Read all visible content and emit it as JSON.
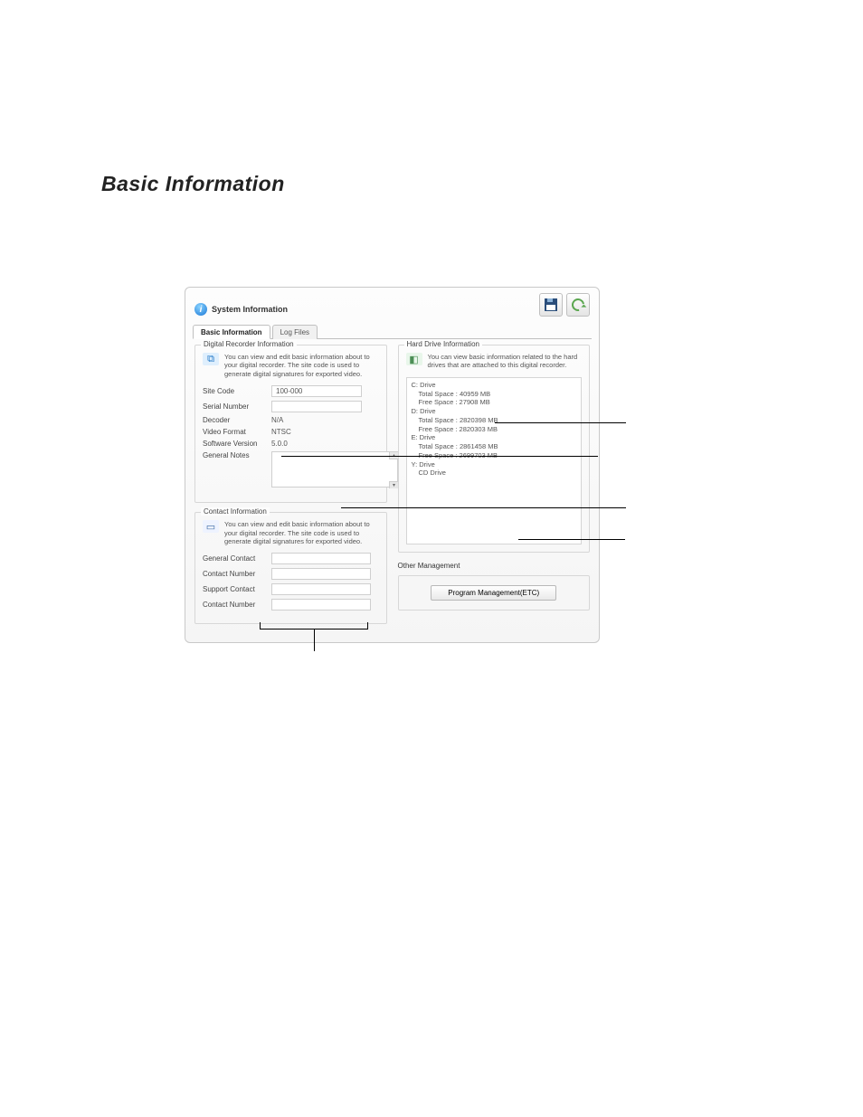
{
  "document": {
    "heading": "Basic Information"
  },
  "dialog": {
    "title": "System Information",
    "header_buttons": {
      "save": "save",
      "recycle": "recycle"
    },
    "tabs": {
      "basic": "Basic Information",
      "log": "Log Files"
    },
    "left": {
      "recorder_group": {
        "legend": "Digital Recorder Information",
        "description": "You can view and edit basic information about to your digital recorder. The site code is used to generate digital signatures for exported video.",
        "rows": {
          "site_code_label": "Site Code",
          "site_code_value": "100-000",
          "serial_label": "Serial Number",
          "serial_value": "",
          "decoder_label": "Decoder",
          "decoder_value": "N/A",
          "format_label": "Video Format",
          "format_value": "NTSC",
          "sw_label": "Software Version",
          "sw_value": "5.0.0",
          "notes_label": "General Notes",
          "notes_value": ""
        }
      },
      "contact_group": {
        "legend": "Contact Information",
        "description": "You can view and edit basic information about to your digital recorder. The site code is used to generate digital signatures for exported video.",
        "rows": {
          "gcontact_label": "General Contact",
          "gcontact_value": "",
          "cnum1_label": "Contact Number",
          "cnum1_value": "",
          "scontact_label": "Support Contact",
          "scontact_value": "",
          "cnum2_label": "Contact Number",
          "cnum2_value": ""
        }
      }
    },
    "right": {
      "hd_group": {
        "legend": "Hard Drive Information",
        "description": "You can view basic information related to the hard drives that are attached to this digital recorder.",
        "drives": {
          "c": {
            "name": "C: Drive",
            "total": "Total Space : 40959 MB",
            "free": "Free Space : 27908 MB"
          },
          "d": {
            "name": "D: Drive",
            "total": "Total Space : 2820398 MB",
            "free": "Free Space : 2820303 MB"
          },
          "e": {
            "name": "E: Drive",
            "total": "Total Space : 2861458 MB",
            "free": "Free Space : 2699703 MB"
          },
          "y": {
            "name": "Y: Drive",
            "type": "CD Drive"
          }
        }
      },
      "other": {
        "legend": "Other Management",
        "button": "Program Management(ETC)"
      }
    }
  }
}
